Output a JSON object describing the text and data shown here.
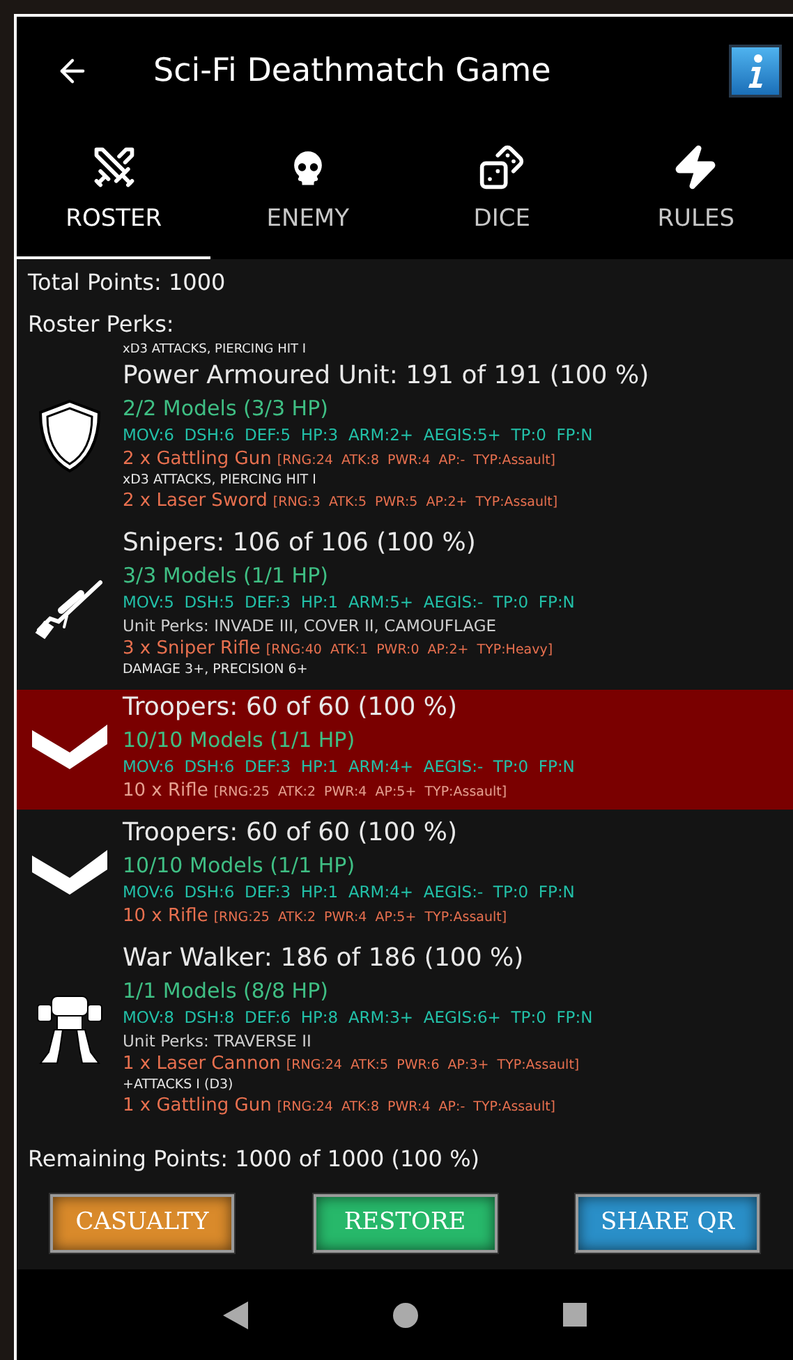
{
  "app_bar": {
    "title": "Sci-Fi Deathmatch Game"
  },
  "tabs": [
    {
      "label": "ROSTER",
      "kind": "swords",
      "selected": true
    },
    {
      "label": "ENEMY",
      "kind": "skull",
      "selected": false
    },
    {
      "label": "DICE",
      "kind": "dice",
      "selected": false
    },
    {
      "label": "RULES",
      "kind": "bolt",
      "selected": false
    }
  ],
  "total_points": "Total Points: 1000",
  "roster_perks": "Roster Perks:",
  "top_note": "xD3 ATTACKS, PIERCING HIT I",
  "units": [
    {
      "kind": "shield",
      "selected": false,
      "title": "Power Armoured Unit: 191 of 191 (100 %)",
      "models": "2/2 Models (3/3 HP)",
      "stats": "MOV:6  DSH:6  DEF:5  HP:3  ARM:2+  AEGIS:5+  TP:0  FP:N",
      "weapons": [
        {
          "name": "2 x Gattling Gun",
          "stats": "[RNG:24  ATK:8  PWR:4  AP:-  TYP:Assault]",
          "note": "xD3 ATTACKS, PIERCING HIT I"
        },
        {
          "name": "2 x Laser Sword",
          "stats": "[RNG:3  ATK:5  PWR:5  AP:2+  TYP:Assault]"
        }
      ]
    },
    {
      "kind": "rifle",
      "selected": false,
      "title": "Snipers: 106 of 106 (100 %)",
      "models": "3/3 Models (1/1 HP)",
      "stats": "MOV:5  DSH:5  DEF:3  HP:1  ARM:5+  AEGIS:-  TP:0  FP:N",
      "perks": "Unit Perks: INVADE III, COVER II, CAMOUFLAGE",
      "weapons": [
        {
          "name": "3 x Sniper Rifle",
          "stats": "[RNG:40  ATK:1  PWR:0  AP:2+  TYP:Heavy]",
          "note": "DAMAGE 3+, PRECISION 6+"
        }
      ]
    },
    {
      "kind": "chevron",
      "selected": true,
      "title": "Troopers: 60 of 60 (100 %)",
      "models": "10/10 Models (1/1 HP)",
      "stats": "MOV:6  DSH:6  DEF:3  HP:1  ARM:4+  AEGIS:-  TP:0  FP:N",
      "weapons": [
        {
          "name": "10 x Rifle",
          "stats": "[RNG:25  ATK:2  PWR:4  AP:5+  TYP:Assault]"
        }
      ]
    },
    {
      "kind": "chevron",
      "selected": false,
      "title": "Troopers: 60 of 60 (100 %)",
      "models": "10/10 Models (1/1 HP)",
      "stats": "MOV:6  DSH:6  DEF:3  HP:1  ARM:4+  AEGIS:-  TP:0  FP:N",
      "weapons": [
        {
          "name": "10 x Rifle",
          "stats": "[RNG:25  ATK:2  PWR:4  AP:5+  TYP:Assault]"
        }
      ]
    },
    {
      "kind": "walker",
      "selected": false,
      "title": "War Walker: 186 of 186 (100 %)",
      "models": "1/1 Models (8/8 HP)",
      "stats": "MOV:8  DSH:8  DEF:6  HP:8  ARM:3+  AEGIS:6+  TP:0  FP:N",
      "perks": "Unit Perks: TRAVERSE II",
      "weapons": [
        {
          "name": "1 x Laser Cannon",
          "stats": "[RNG:24  ATK:5  PWR:6  AP:3+  TYP:Assault]",
          "note": "+ATTACKS I (D3)"
        },
        {
          "name": "1 x Gattling Gun",
          "stats": "[RNG:24  ATK:8  PWR:4  AP:-  TYP:Assault]"
        }
      ]
    }
  ],
  "remaining_points": "Remaining Points: 1000 of 1000 (100 %)",
  "buttons": [
    {
      "label": "CASUALTY",
      "color": "#d98a2b"
    },
    {
      "label": "RESTORE",
      "color": "#27b86a"
    },
    {
      "label": "SHARE QR",
      "color": "#2a8fc8"
    }
  ]
}
